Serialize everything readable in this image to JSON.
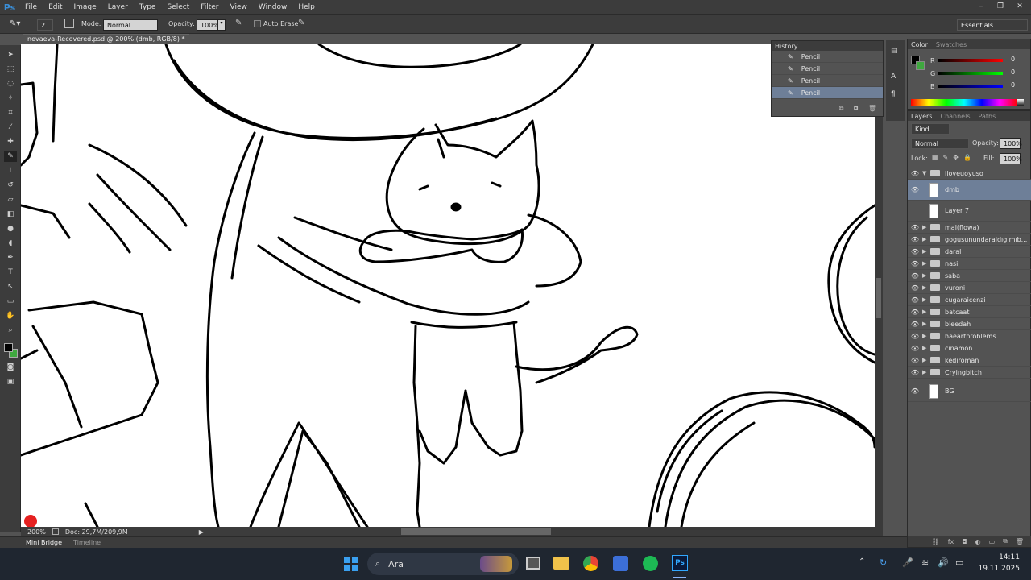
{
  "menu": {
    "logo": "Ps",
    "items": [
      "File",
      "Edit",
      "Image",
      "Layer",
      "Type",
      "Select",
      "Filter",
      "View",
      "Window",
      "Help"
    ]
  },
  "window_controls": [
    "–",
    "❐",
    "✕"
  ],
  "options": {
    "brush_size": "2",
    "mode_label": "Mode:",
    "mode_value": "Normal",
    "opacity_label": "Opacity:",
    "opacity_value": "100%",
    "auto_erase": "Auto Erase",
    "workspace": "Essentials"
  },
  "document_tab": "nevaeva-Recovered.psd @ 200% (dmb, RGB/8) *",
  "history": {
    "title": "History",
    "items": [
      "Pencil",
      "Pencil",
      "Pencil",
      "Pencil"
    ],
    "selected_index": 3
  },
  "color_panel": {
    "tabs": [
      "Color",
      "Swatches"
    ],
    "channels": [
      {
        "label": "R",
        "value": "0"
      },
      {
        "label": "G",
        "value": "0"
      },
      {
        "label": "B",
        "value": "0"
      }
    ]
  },
  "layers_panel": {
    "tabs": [
      "Layers",
      "Channels",
      "Paths"
    ],
    "kind": "Kind",
    "blend_mode": "Normal",
    "opacity_label": "Opacity:",
    "opacity_value": "100%",
    "lock_label": "Lock:",
    "fill_label": "Fill:",
    "fill_value": "100%",
    "layers": [
      {
        "name": "iloveuoyuso",
        "type": "group-open",
        "visible": true
      },
      {
        "name": "dmb",
        "type": "layer",
        "visible": true,
        "selected": true
      },
      {
        "name": "Layer 7",
        "type": "layer",
        "visible": false
      },
      {
        "name": "mal(flowa)",
        "type": "group",
        "visible": true
      },
      {
        "name": "gogusunundaraldıgımıb...",
        "type": "group",
        "visible": true
      },
      {
        "name": "daral",
        "type": "group",
        "visible": true
      },
      {
        "name": "nasi",
        "type": "group",
        "visible": true
      },
      {
        "name": "saba",
        "type": "group",
        "visible": true
      },
      {
        "name": "vuroni",
        "type": "group",
        "visible": true
      },
      {
        "name": "cugaraicenzi",
        "type": "group",
        "visible": true
      },
      {
        "name": "batcaat",
        "type": "group",
        "visible": true
      },
      {
        "name": "bleedah",
        "type": "group",
        "visible": true
      },
      {
        "name": "haeartproblems",
        "type": "group",
        "visible": true
      },
      {
        "name": "cinamon",
        "type": "group",
        "visible": true
      },
      {
        "name": "kediroman",
        "type": "group",
        "visible": true
      },
      {
        "name": "Cryingbitch",
        "type": "group",
        "visible": true
      },
      {
        "name": "BG",
        "type": "background",
        "visible": true
      }
    ]
  },
  "status": {
    "zoom": "200%",
    "doc_info": "Doc: 29,7M/209,9M"
  },
  "bottom_tabs": [
    "Mini Bridge",
    "Timeline"
  ],
  "taskbar": {
    "search_placeholder": "Ara",
    "time": "14:11",
    "date": "19.11.2025"
  },
  "colors": {
    "foreground": "#000000",
    "background": "#3fa83f",
    "selection": "#6e7f98"
  }
}
